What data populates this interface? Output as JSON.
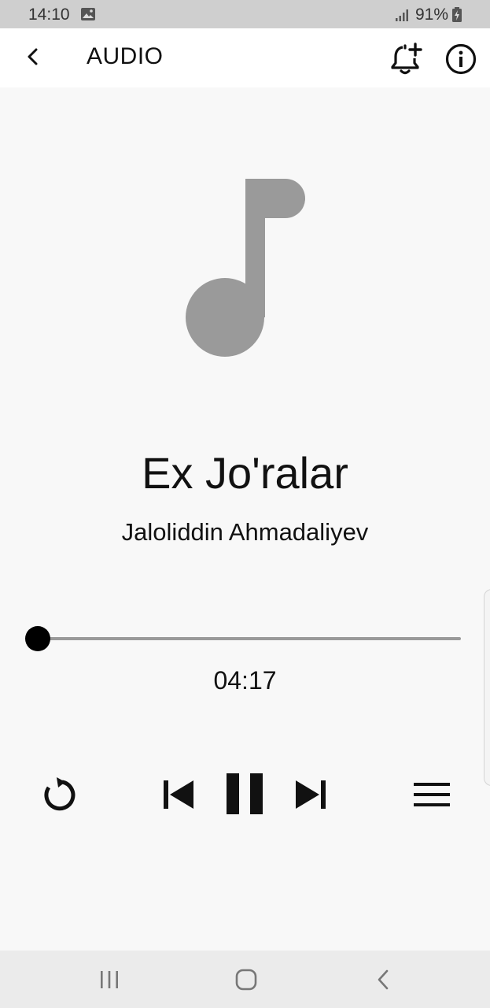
{
  "status_bar": {
    "time": "14:10",
    "battery": "91%",
    "icons": [
      "image-icon",
      "signal-icon",
      "battery-charging-icon"
    ]
  },
  "app_bar": {
    "title": "AUDIO",
    "icons": [
      "back-arrow-icon",
      "bell-plus-icon",
      "info-icon"
    ]
  },
  "track": {
    "title": "Ex Jo'ralar",
    "artist": "Jaloliddin Ahmadaliyev",
    "duration": "04:17",
    "progress": 0.0,
    "artwork_icon": "music-note-icon"
  },
  "controls": {
    "icons": [
      "repeat-icon",
      "skip-previous-icon",
      "pause-icon",
      "skip-next-icon",
      "queue-list-icon"
    ]
  },
  "nav_bar": {
    "icons": [
      "recents-icon",
      "home-icon",
      "back-icon"
    ]
  },
  "colors": {
    "background": "#f8f8f8",
    "app_bar": "#ffffff",
    "status_bar": "#cfcfcf",
    "artwork": "#9a9a9a",
    "seek_track": "#9a9a9a",
    "accent": "#000000",
    "nav_bar": "#ebebeb"
  }
}
